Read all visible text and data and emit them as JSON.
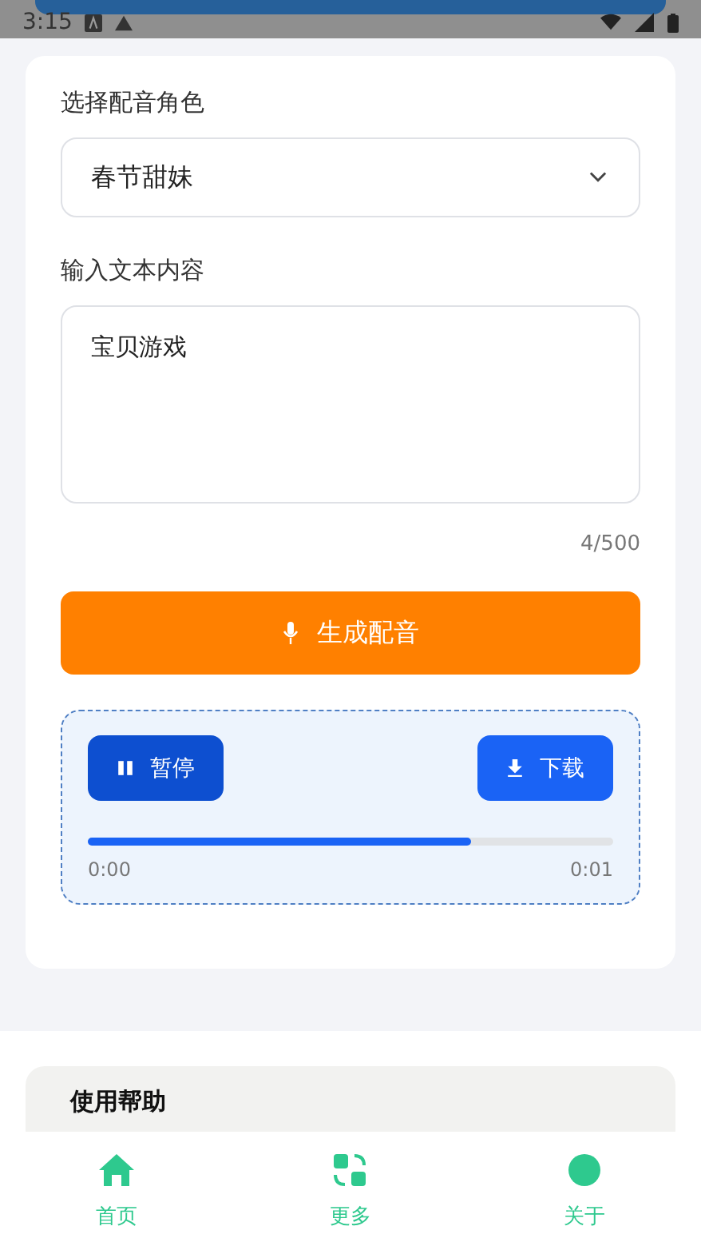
{
  "status_bar": {
    "time": "3:15"
  },
  "form": {
    "voice_label": "选择配音角色",
    "voice_value": "春节甜妹",
    "text_label": "输入文本内容",
    "text_value": "宝贝游戏",
    "counter": "4/500",
    "generate_button": "生成配音"
  },
  "player": {
    "playing": true,
    "pause_button": "暂停",
    "download_button": "下载",
    "level": 0.73,
    "current_time": "0:00",
    "total_time": "0:01"
  },
  "help": {
    "title": "使用帮助"
  },
  "nav": [
    {
      "label": "首页",
      "kind": "home"
    },
    {
      "label": "更多",
      "kind": "more"
    },
    {
      "label": "关于",
      "kind": "about"
    }
  ]
}
